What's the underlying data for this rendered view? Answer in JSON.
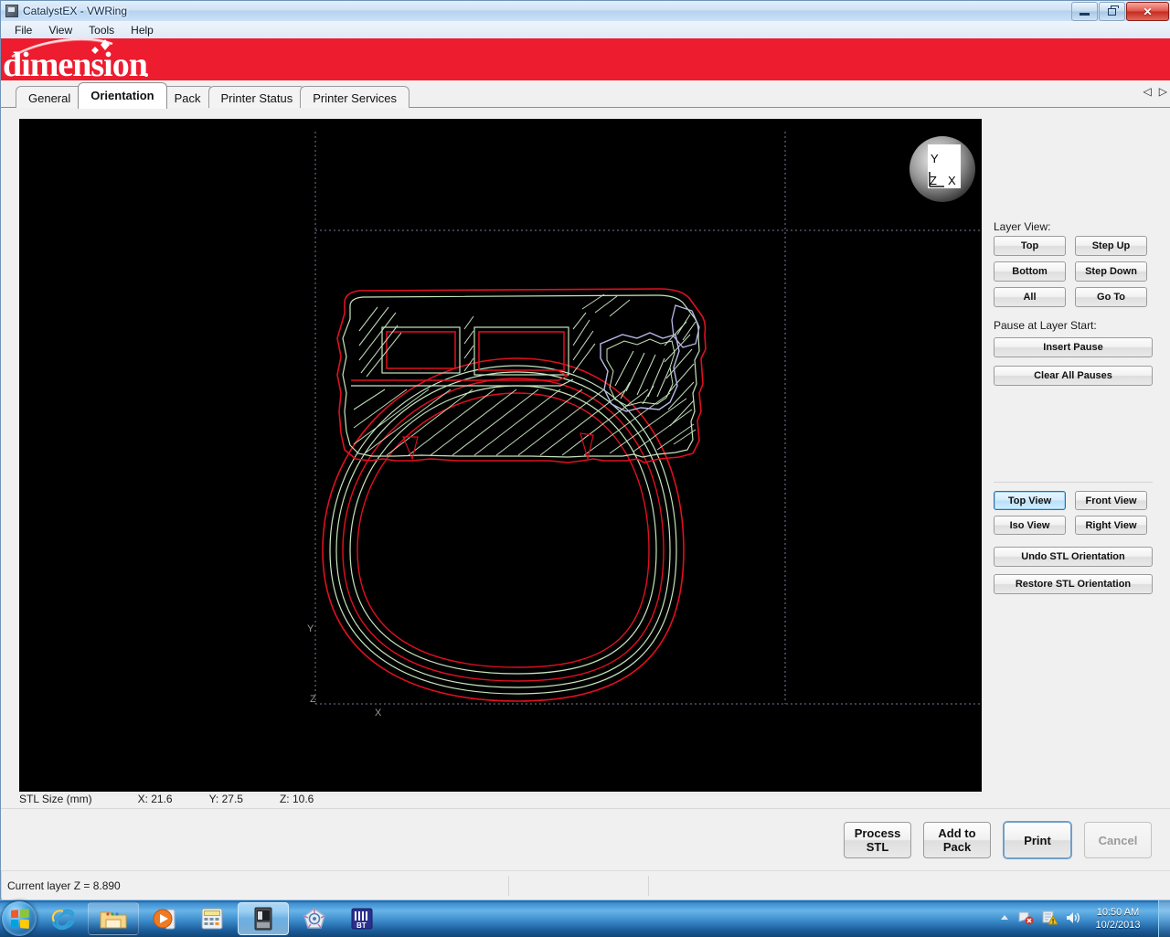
{
  "window": {
    "title": "CatalystEX - VWRing",
    "icon": "app-icon",
    "controls": {
      "minimize": "Minimize",
      "restore": "Restore",
      "close": "Close"
    }
  },
  "menu": {
    "items": [
      "File",
      "View",
      "Tools",
      "Help"
    ]
  },
  "banner": {
    "brand": "dimension",
    "color": "#ed1c2e"
  },
  "tabs": {
    "items": [
      {
        "label": "General",
        "active": false
      },
      {
        "label": "Orientation",
        "active": true
      },
      {
        "label": "Pack",
        "active": false
      },
      {
        "label": "Printer Status",
        "active": false
      },
      {
        "label": "Printer Services",
        "active": false
      }
    ],
    "scroll_left": "◁",
    "scroll_right": "▷"
  },
  "viewport": {
    "background": "#000000",
    "axis_labels": {
      "y": "Y",
      "z": "Z",
      "x": "X"
    },
    "nav_cube": {
      "y": "Y",
      "z": "Z",
      "x": "X"
    },
    "colors": {
      "contour": "#e01020",
      "raster": "#c8e6c0",
      "support": "#b9b9e8",
      "grid": "#8f8fb4",
      "axis_text": "#9a9a9a"
    }
  },
  "stl_size": {
    "label": "STL Size (mm)",
    "x": "X:  21.6",
    "y": "Y:  27.5",
    "z": "Z:  10.6"
  },
  "right_panel": {
    "layer_view_label": "Layer View:",
    "layer_buttons": [
      "Top",
      "Step Up",
      "Bottom",
      "Step Down",
      "All",
      "Go To"
    ],
    "pause_label": "Pause at Layer Start:",
    "insert_pause": "Insert Pause",
    "clear_all_pauses": "Clear All Pauses",
    "view_buttons": [
      {
        "label": "Top View",
        "selected": true
      },
      {
        "label": "Front View",
        "selected": false
      },
      {
        "label": "Iso View",
        "selected": false
      },
      {
        "label": "Right View",
        "selected": false
      }
    ],
    "undo_orientation": "Undo STL Orientation",
    "restore_orientation": "Restore STL Orientation"
  },
  "actions": [
    {
      "label": "Process\nSTL",
      "enabled": true,
      "default": false
    },
    {
      "label": "Add to\nPack",
      "enabled": true,
      "default": false
    },
    {
      "label": "Print",
      "enabled": true,
      "default": true
    },
    {
      "label": "Cancel",
      "enabled": false,
      "default": false
    }
  ],
  "status_bar": {
    "cells": [
      "Current layer Z = 8.890",
      "",
      ""
    ]
  },
  "taskbar": {
    "start": "start-orb",
    "items": [
      {
        "name": "internet-explorer",
        "active": false
      },
      {
        "name": "file-explorer",
        "active": false
      },
      {
        "name": "media-player",
        "active": false
      },
      {
        "name": "calculator",
        "active": false
      },
      {
        "name": "catalystex-printer",
        "active": true
      },
      {
        "name": "design-app",
        "active": false
      },
      {
        "name": "bt-app",
        "active": false,
        "text": "BT"
      }
    ],
    "tray": {
      "time": "10:50 AM",
      "date": "10/2/2013"
    }
  }
}
